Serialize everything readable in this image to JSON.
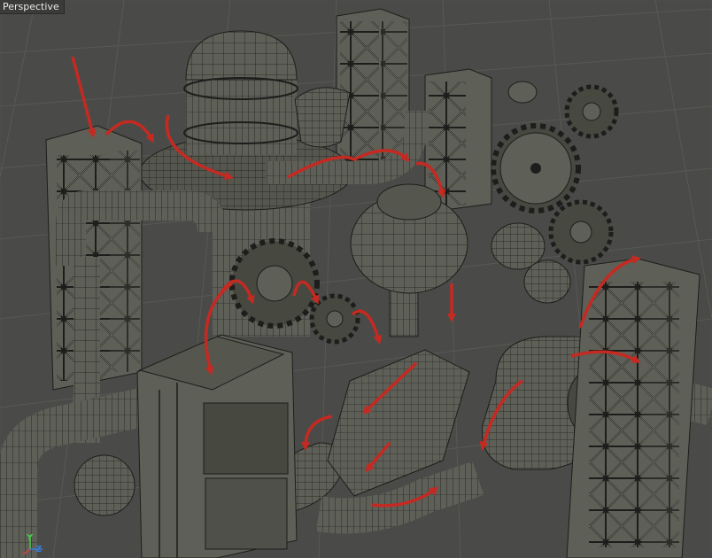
{
  "viewport": {
    "label": "Perspective",
    "display_mode": "wireframe-on-shaded",
    "colors": {
      "background": "#4a4b48",
      "grid": "#5d5e5a",
      "model_fill": "#5e5f57",
      "model_dark": "#474840",
      "wire": "#1d1d1b",
      "annotation_arrow": "#c42a22"
    }
  },
  "axis_gizmo": {
    "y_label": "Y",
    "z_label": "Z",
    "y_color": "#46c646",
    "z_color": "#3a7bd8",
    "x_color": "#d64242"
  },
  "scene": {
    "objects": [
      "domed-tank",
      "lattice-tower-left",
      "lattice-tower-back",
      "lattice-tower-mid",
      "lattice-tower-right",
      "lattice-tower-center",
      "gear-large-right",
      "gear-small-top-right",
      "gear-center",
      "gear-left-small",
      "gear-mid-right",
      "sphere-tank-center",
      "sphere-tank-left-bottom",
      "satellite-dish-front",
      "satellite-dish-right",
      "pipe-left",
      "pipe-right",
      "control-cabinet",
      "funnel-bowl",
      "ramp-chute"
    ],
    "annotation_arrow_count": 13
  }
}
